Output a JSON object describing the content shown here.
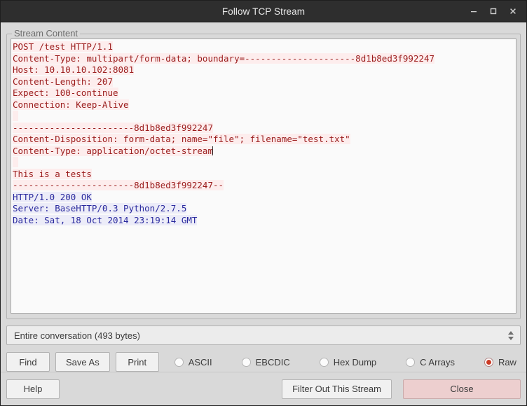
{
  "window": {
    "title": "Follow TCP Stream",
    "controls": [
      {
        "name": "minimize-button",
        "glyph": "minimize"
      },
      {
        "name": "maximize-button",
        "glyph": "maximize"
      },
      {
        "name": "close-button",
        "glyph": "close"
      }
    ]
  },
  "groupbox": {
    "title": "Stream Content"
  },
  "stream": {
    "request_color": "#9b1c1c",
    "response_color": "#2a2a9e",
    "request_bg": "#fdeded",
    "response_bg": "#ececf8",
    "lines": [
      {
        "kind": "request",
        "text": "POST /test HTTP/1.1"
      },
      {
        "kind": "request",
        "text": "Content-Type: multipart/form-data; boundary=---------------------8d1b8ed3f992247"
      },
      {
        "kind": "request",
        "text": "Host: 10.10.10.102:8081"
      },
      {
        "kind": "request",
        "text": "Content-Length: 207"
      },
      {
        "kind": "request",
        "text": "Expect: 100-continue"
      },
      {
        "kind": "request",
        "text": "Connection: Keep-Alive"
      },
      {
        "kind": "request",
        "text": ""
      },
      {
        "kind": "request",
        "text": "-----------------------8d1b8ed3f992247"
      },
      {
        "kind": "request",
        "text": "Content-Disposition: form-data; name=\"file\"; filename=\"test.txt\""
      },
      {
        "kind": "request",
        "text": "Content-Type: application/octet-stream",
        "caret": true
      },
      {
        "kind": "request",
        "text": ""
      },
      {
        "kind": "request",
        "text": "This is a tests"
      },
      {
        "kind": "request",
        "text": "-----------------------8d1b8ed3f992247--"
      },
      {
        "kind": "response",
        "text": "HTTP/1.0 200 OK"
      },
      {
        "kind": "response",
        "text": "Server: BaseHTTP/0.3 Python/2.7.5"
      },
      {
        "kind": "response",
        "text": "Date: Sat, 18 Oct 2014 23:19:14 GMT"
      }
    ]
  },
  "conversation_select": {
    "value": "Entire conversation (493 bytes)"
  },
  "actions": {
    "find_label": "Find",
    "save_as_label": "Save As",
    "print_label": "Print"
  },
  "formats": [
    {
      "label": "ASCII",
      "checked": false
    },
    {
      "label": "EBCDIC",
      "checked": false
    },
    {
      "label": "Hex Dump",
      "checked": false
    },
    {
      "label": "C Arrays",
      "checked": false
    },
    {
      "label": "Raw",
      "checked": true
    }
  ],
  "footer": {
    "help_label": "Help",
    "filter_label": "Filter Out This Stream",
    "close_label": "Close",
    "close_accent": "#edcfcf"
  }
}
